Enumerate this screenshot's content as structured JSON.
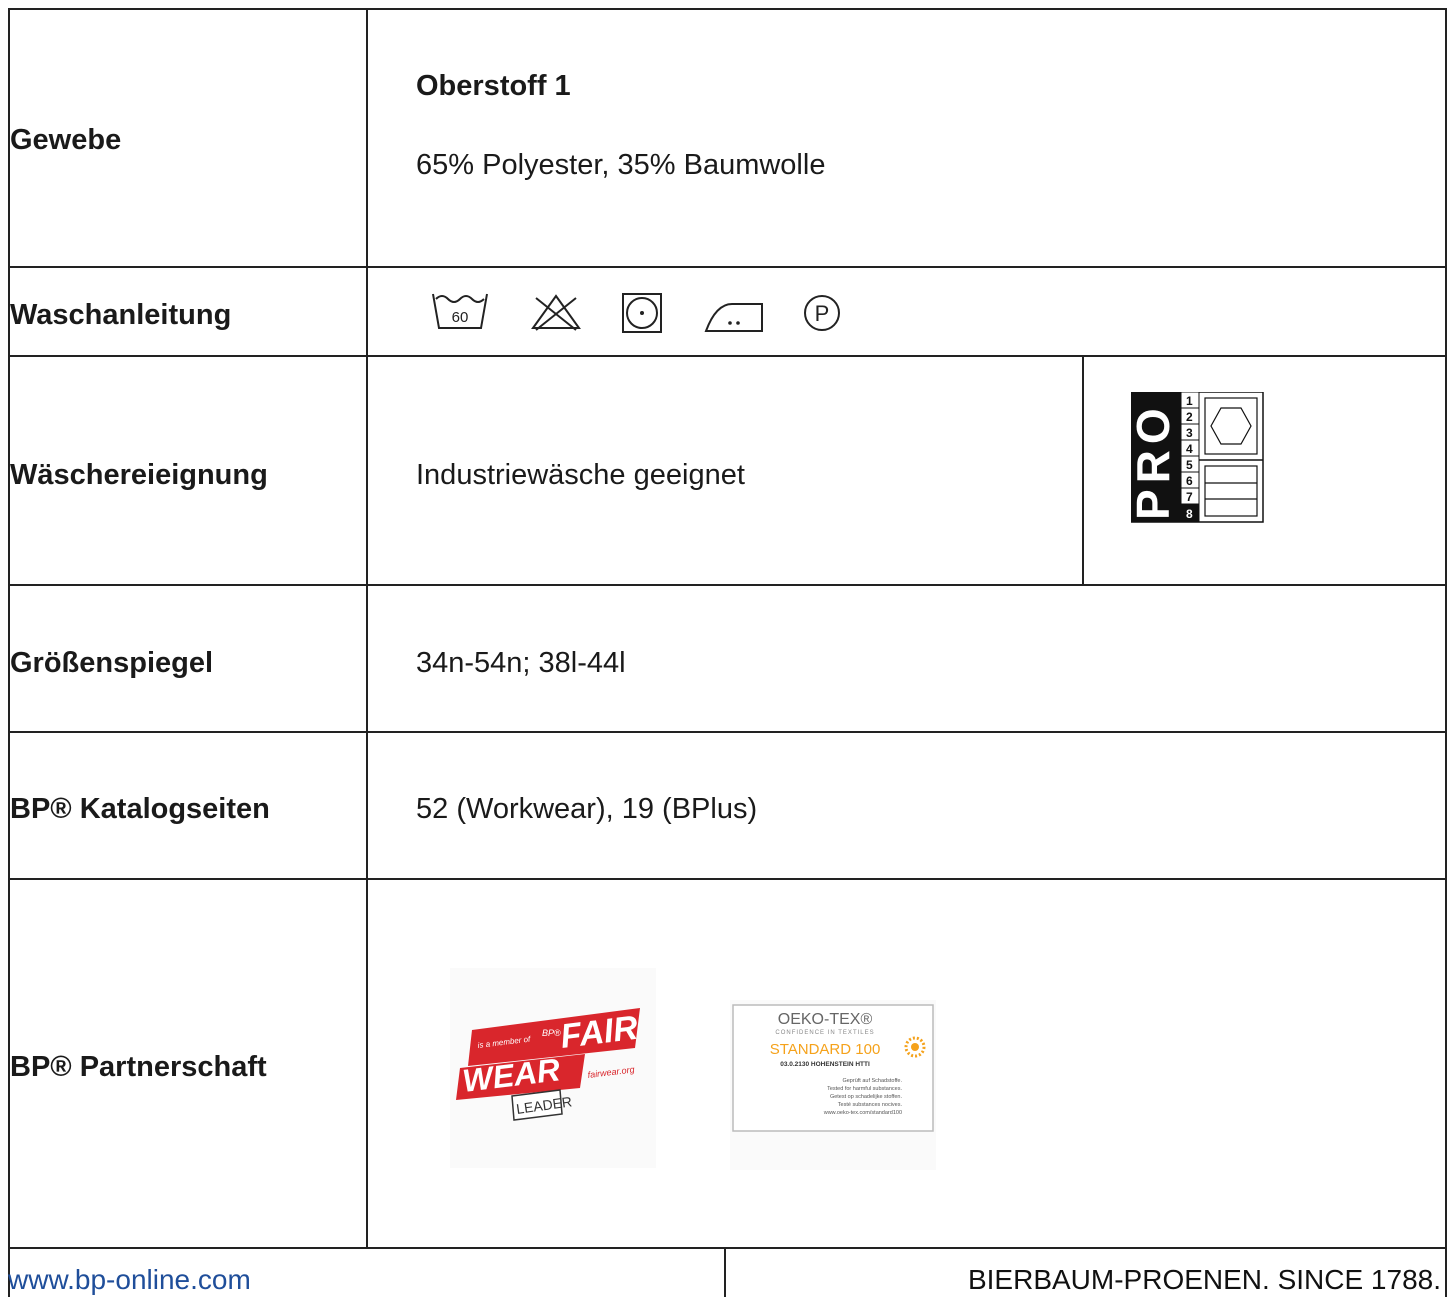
{
  "rows": {
    "gewebe": {
      "label": "Gewebe",
      "heading": "Oberstoff 1",
      "value": "65% Polyester, 35% Baumwolle"
    },
    "waschanleitung": {
      "label": "Waschanleitung",
      "wash_temp": "60",
      "professional_care": "P"
    },
    "waeschereieignung": {
      "label": "Wäschereieignung",
      "value": "Industriewäsche geeignet",
      "pro_logo": {
        "text": "PRO",
        "scale": [
          "1",
          "2",
          "3",
          "4",
          "5",
          "6",
          "7",
          "8"
        ]
      }
    },
    "groessenspiegel": {
      "label": "Größenspiegel",
      "value": "34n-54n; 38l-44l"
    },
    "katalogseiten": {
      "label": "BP® Katalogseiten",
      "value": "52 (Workwear), 19 (BPlus)"
    },
    "partnerschaft": {
      "label": "BP® Partnerschaft",
      "fairwear": {
        "small": "BP®",
        "member": "is a member of",
        "fair": "FAIR",
        "wear": "WEAR",
        "url": "fairwear.org",
        "leader": "LEADER"
      },
      "oekotex": {
        "title": "OEKO-TEX®",
        "tagline": "CONFIDENCE IN TEXTILES",
        "standard": "STANDARD 100",
        "cert": "03.0.2130 HOHENSTEIN HTTI",
        "lines": [
          "Geprüft auf Schadstoffe.",
          "Tested for harmful substances.",
          "Getest op schadelijke stoffen.",
          "Testé substances nocives.",
          "www.oeko-tex.com/standard100"
        ]
      }
    }
  },
  "footer": {
    "website": "www.bp-online.com",
    "tagline": "BIERBAUM-PROENEN. SINCE 1788."
  },
  "colors": {
    "link": "#1f4e9a",
    "fairwear_red": "#d9262c",
    "oekotex_orange": "#f5a21b"
  }
}
